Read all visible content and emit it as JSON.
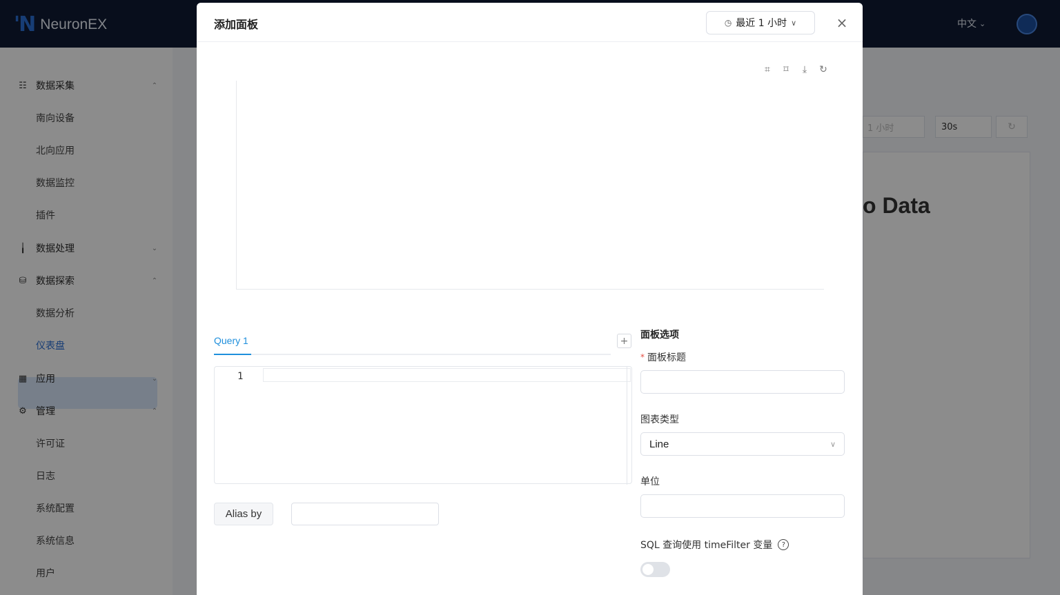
{
  "topbar": {
    "logo_mark": "'N",
    "app_name": "NeuronEX",
    "language": "中文",
    "language_chevron": "⌄"
  },
  "sidebar": {
    "groups": [
      {
        "label": "数据采集",
        "icon": "list-icon",
        "chevron": "⌃",
        "expanded": true
      },
      {
        "label": "数据处理",
        "icon": "bars-icon",
        "chevron": "⌄",
        "expanded": false
      },
      {
        "label": "数据探索",
        "icon": "database-icon",
        "chevron": "⌃",
        "expanded": true
      },
      {
        "label": "应用",
        "icon": "apps-icon",
        "chevron": "⌄",
        "expanded": false
      },
      {
        "label": "管理",
        "icon": "gear-icon",
        "chevron": "⌃",
        "expanded": true
      }
    ],
    "sub_items": {
      "collect": [
        "南向设备",
        "北向应用",
        "数据监控",
        "插件"
      ],
      "explore": [
        "数据分析",
        "仪表盘"
      ],
      "admin": [
        "许可证",
        "日志",
        "系统配置",
        "系统信息",
        "用户"
      ]
    },
    "active_item": "仪表盘"
  },
  "background": {
    "time_select": "1 小时",
    "refresh_select": "30s",
    "no_data_text": "o Data"
  },
  "modal": {
    "title": "添加面板",
    "time_range": "最近 1 小时",
    "close_glyph": "×",
    "chart_tools": [
      "zoom-icon",
      "zoom-reset-icon",
      "download-icon",
      "refresh-icon"
    ],
    "query": {
      "tab_label": "Query 1",
      "add_glyph": "+",
      "line_number": "1",
      "sql": "",
      "alias_label": "Alias by",
      "alias_value": ""
    },
    "options": {
      "heading": "面板选项",
      "title_label": "面板标题",
      "title_required": "*",
      "title_value": "",
      "chart_type_label": "图表类型",
      "chart_type_value": "Line",
      "unit_label": "单位",
      "unit_value": "",
      "timefilter_label": "SQL 查询使用 timeFilter 变量",
      "timefilter_enabled": false
    }
  },
  "colors": {
    "topbar": "#0f1b34",
    "accent": "#1f8fdc",
    "active_bg": "#d9e8fb",
    "required": "#e54d42"
  }
}
